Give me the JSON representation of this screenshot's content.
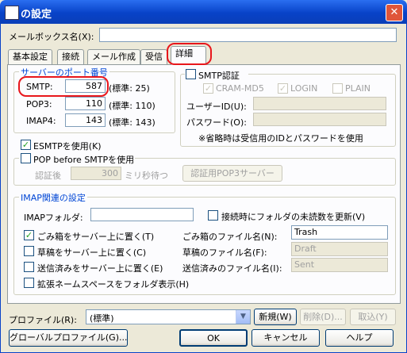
{
  "window": {
    "title": "の設定"
  },
  "mailbox": {
    "label": "メールボックス名(X):",
    "value": ""
  },
  "tabs": [
    "基本設定",
    "接続",
    "メール作成",
    "受信",
    "詳細"
  ],
  "server_port": {
    "title": "サーバーのポート番号",
    "smtp_label": "SMTP:",
    "smtp_value": "587",
    "smtp_default": "(標準: 25)",
    "pop3_label": "POP3:",
    "pop3_value": "110",
    "pop3_default": "(標準: 110)",
    "imap4_label": "IMAP4:",
    "imap4_value": "143",
    "imap4_default": "(標準: 143)"
  },
  "smtp_auth": {
    "label": "SMTP認証",
    "cram_md5": "CRAM-MD5",
    "login": "LOGIN",
    "plain": "PLAIN",
    "userid_label": "ユーザーID(U):",
    "password_label": "パスワード(O):",
    "note": "※省略時は受信用のIDとパスワードを使用"
  },
  "esmtp": {
    "label": "ESMTPを使用(K)"
  },
  "pop_before": {
    "label": "POP before SMTPを使用",
    "wait_label": "認証後",
    "wait_value": "300",
    "wait_unit": "ミリ秒待つ",
    "server_button": "認証用POP3サーバー"
  },
  "imap": {
    "title": "IMAP関連の設定",
    "folder_label": "IMAPフォルダ:",
    "folder_value": "",
    "unread_label": "接続時にフォルダの未読数を更新(V)",
    "trash_cb": "ごみ箱をサーバー上に置く(T)",
    "trash_name_label": "ごみ箱のファイル名(N):",
    "trash_name_value": "Trash",
    "draft_cb": "草稿をサーバー上に置く(C)",
    "draft_name_label": "草稿のファイル名(F):",
    "draft_name_value": "Draft",
    "sent_cb": "送信済みをサーバー上に置く(E)",
    "sent_name_label": "送信済みのファイル名(I):",
    "sent_name_value": "Sent",
    "ext_ns": "拡張ネームスペースをフォルダ表示(H)"
  },
  "profile": {
    "label": "プロファイル(R):",
    "value": "(標準)",
    "new_button": "新規(W)",
    "delete_button": "削除(D)...",
    "rename_button": "取込(Y)"
  },
  "buttons": {
    "global_profile": "グローバルプロファイル(G)...",
    "ok": "OK",
    "cancel": "キャンセル",
    "help": "ヘルプ"
  }
}
